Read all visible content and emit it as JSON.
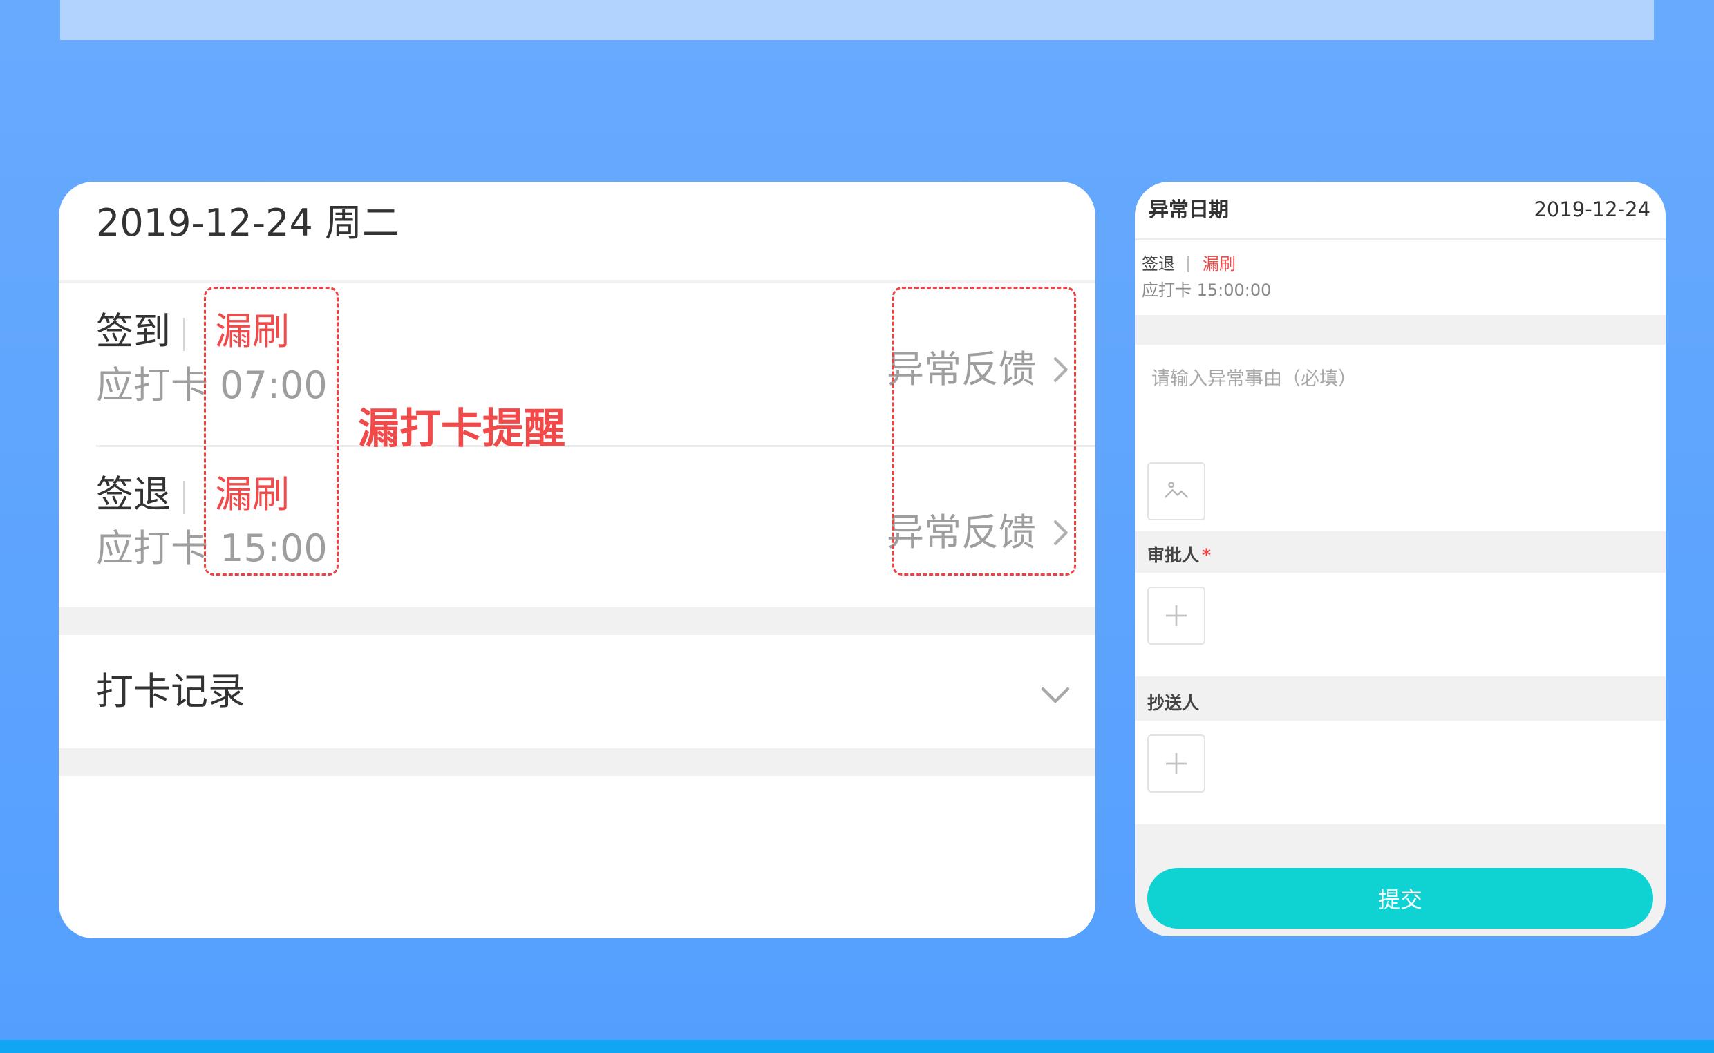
{
  "colors": {
    "background_top": "#68aafe",
    "background_bottom": "#549ffe",
    "missed": "#f04a4a",
    "submit": "#0fd3d3"
  },
  "attendance": {
    "date": "2019-12-24 周二",
    "check_in": {
      "label": "签到",
      "status": "漏刷",
      "scheduled_prefix": "应打卡",
      "scheduled_time": "07:00",
      "feedback": "异常反馈"
    },
    "check_out": {
      "label": "签退",
      "status": "漏刷",
      "scheduled_prefix": "应打卡",
      "scheduled_time": "15:00",
      "feedback": "异常反馈"
    },
    "annotation": "漏打卡提醒",
    "records_label": "打卡记录"
  },
  "feedback_form": {
    "date_label": "异常日期",
    "date_value": "2019-12-24",
    "status_label": "签退",
    "status_value": "漏刷",
    "scheduled_time": "应打卡 15:00:00",
    "reason_placeholder": "请输入异常事由（必填）",
    "approver_label": "审批人",
    "approver_required_mark": "*",
    "cc_label": "抄送人",
    "submit_label": "提交",
    "icons": [
      "image-upload-icon",
      "plus-icon"
    ]
  }
}
